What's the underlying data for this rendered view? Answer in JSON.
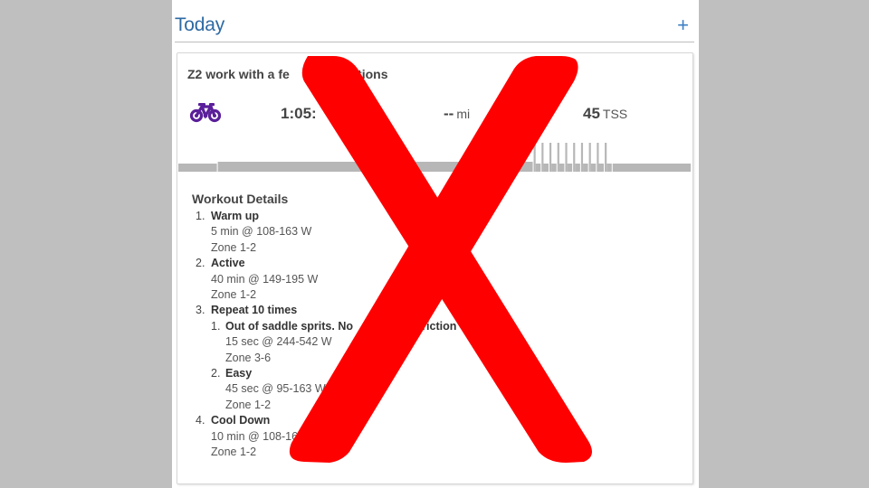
{
  "header": {
    "title": "Today",
    "add_label": "+"
  },
  "workout": {
    "title_visible_start": "Z2 work with a fe",
    "title_visible_end": "rations",
    "sport_icon": "bike-icon",
    "sport_icon_color": "#5b1f9a",
    "duration": "1:05:",
    "distance_value": "--",
    "distance_unit": "mi",
    "tss_value": "45",
    "tss_unit": "TSS",
    "graph": {
      "color": "#b7b7b7",
      "segments": [
        {
          "name": "warm-up",
          "minutes": 5,
          "intensity": "low"
        },
        {
          "name": "active",
          "minutes": 40,
          "intensity": "medium"
        },
        {
          "name": "intervals",
          "repeat": 10,
          "on_seconds": 15,
          "off_seconds": 45,
          "on_intensity": "high",
          "off_intensity": "low"
        },
        {
          "name": "cool-down",
          "minutes": 10,
          "intensity": "low"
        }
      ]
    }
  },
  "details": {
    "title": "Workout Details",
    "steps": [
      {
        "num": "1.",
        "name": "Warm up",
        "lines": [
          "5 min @ 108-163 W",
          "Zone 1-2"
        ]
      },
      {
        "num": "2.",
        "name": "Active",
        "lines": [
          "40 min @ 149-195 W",
          "Zone 1-2"
        ]
      },
      {
        "num": "3.",
        "name": "Repeat 10 times",
        "lines": [],
        "substeps": [
          {
            "num": "1.",
            "name": "Out of saddle sprits. No",
            "name_end": "triction",
            "lines": [
              "15 sec @ 244-542 W",
              "Zone 3-6"
            ]
          },
          {
            "num": "2.",
            "name": "Easy",
            "lines": [
              "45 sec @ 95-163 W",
              "Zone 1-2"
            ]
          }
        ]
      },
      {
        "num": "4.",
        "name": "Cool Down",
        "lines": [
          "10 min @ 108-16",
          "Zone 1-2"
        ]
      }
    ]
  },
  "overlay": {
    "symbol": "X",
    "color": "#ff0000"
  }
}
